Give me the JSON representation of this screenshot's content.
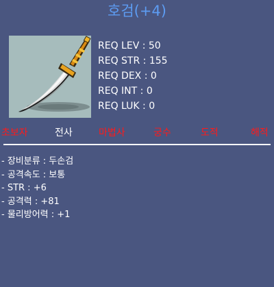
{
  "item": {
    "name": "호검(+4)",
    "icon": "sword-icon"
  },
  "requirements": [
    "REQ LEV : 50",
    "REQ STR : 155",
    "REQ DEX : 0",
    "REQ INT : 0",
    "REQ LUK : 0"
  ],
  "jobs": [
    {
      "label": "초보자",
      "active": false
    },
    {
      "label": "전사",
      "active": true
    },
    {
      "label": "마법사",
      "active": false
    },
    {
      "label": "궁수",
      "active": false
    },
    {
      "label": "도적",
      "active": false
    },
    {
      "label": "해적",
      "active": false
    }
  ],
  "stats": [
    "- 장비분류 : 두손검",
    "- 공격속도 : 보통",
    "- STR : +6",
    "- 공격력 : +81",
    "- 물리방어력 : +1"
  ],
  "colors": {
    "background": "#4a5680",
    "title": "#5d9cf2",
    "icon_bg": "#a6bcbc",
    "job_unavailable": "#ff1a1a",
    "job_available": "#ffffff",
    "text": "#ffffff"
  }
}
